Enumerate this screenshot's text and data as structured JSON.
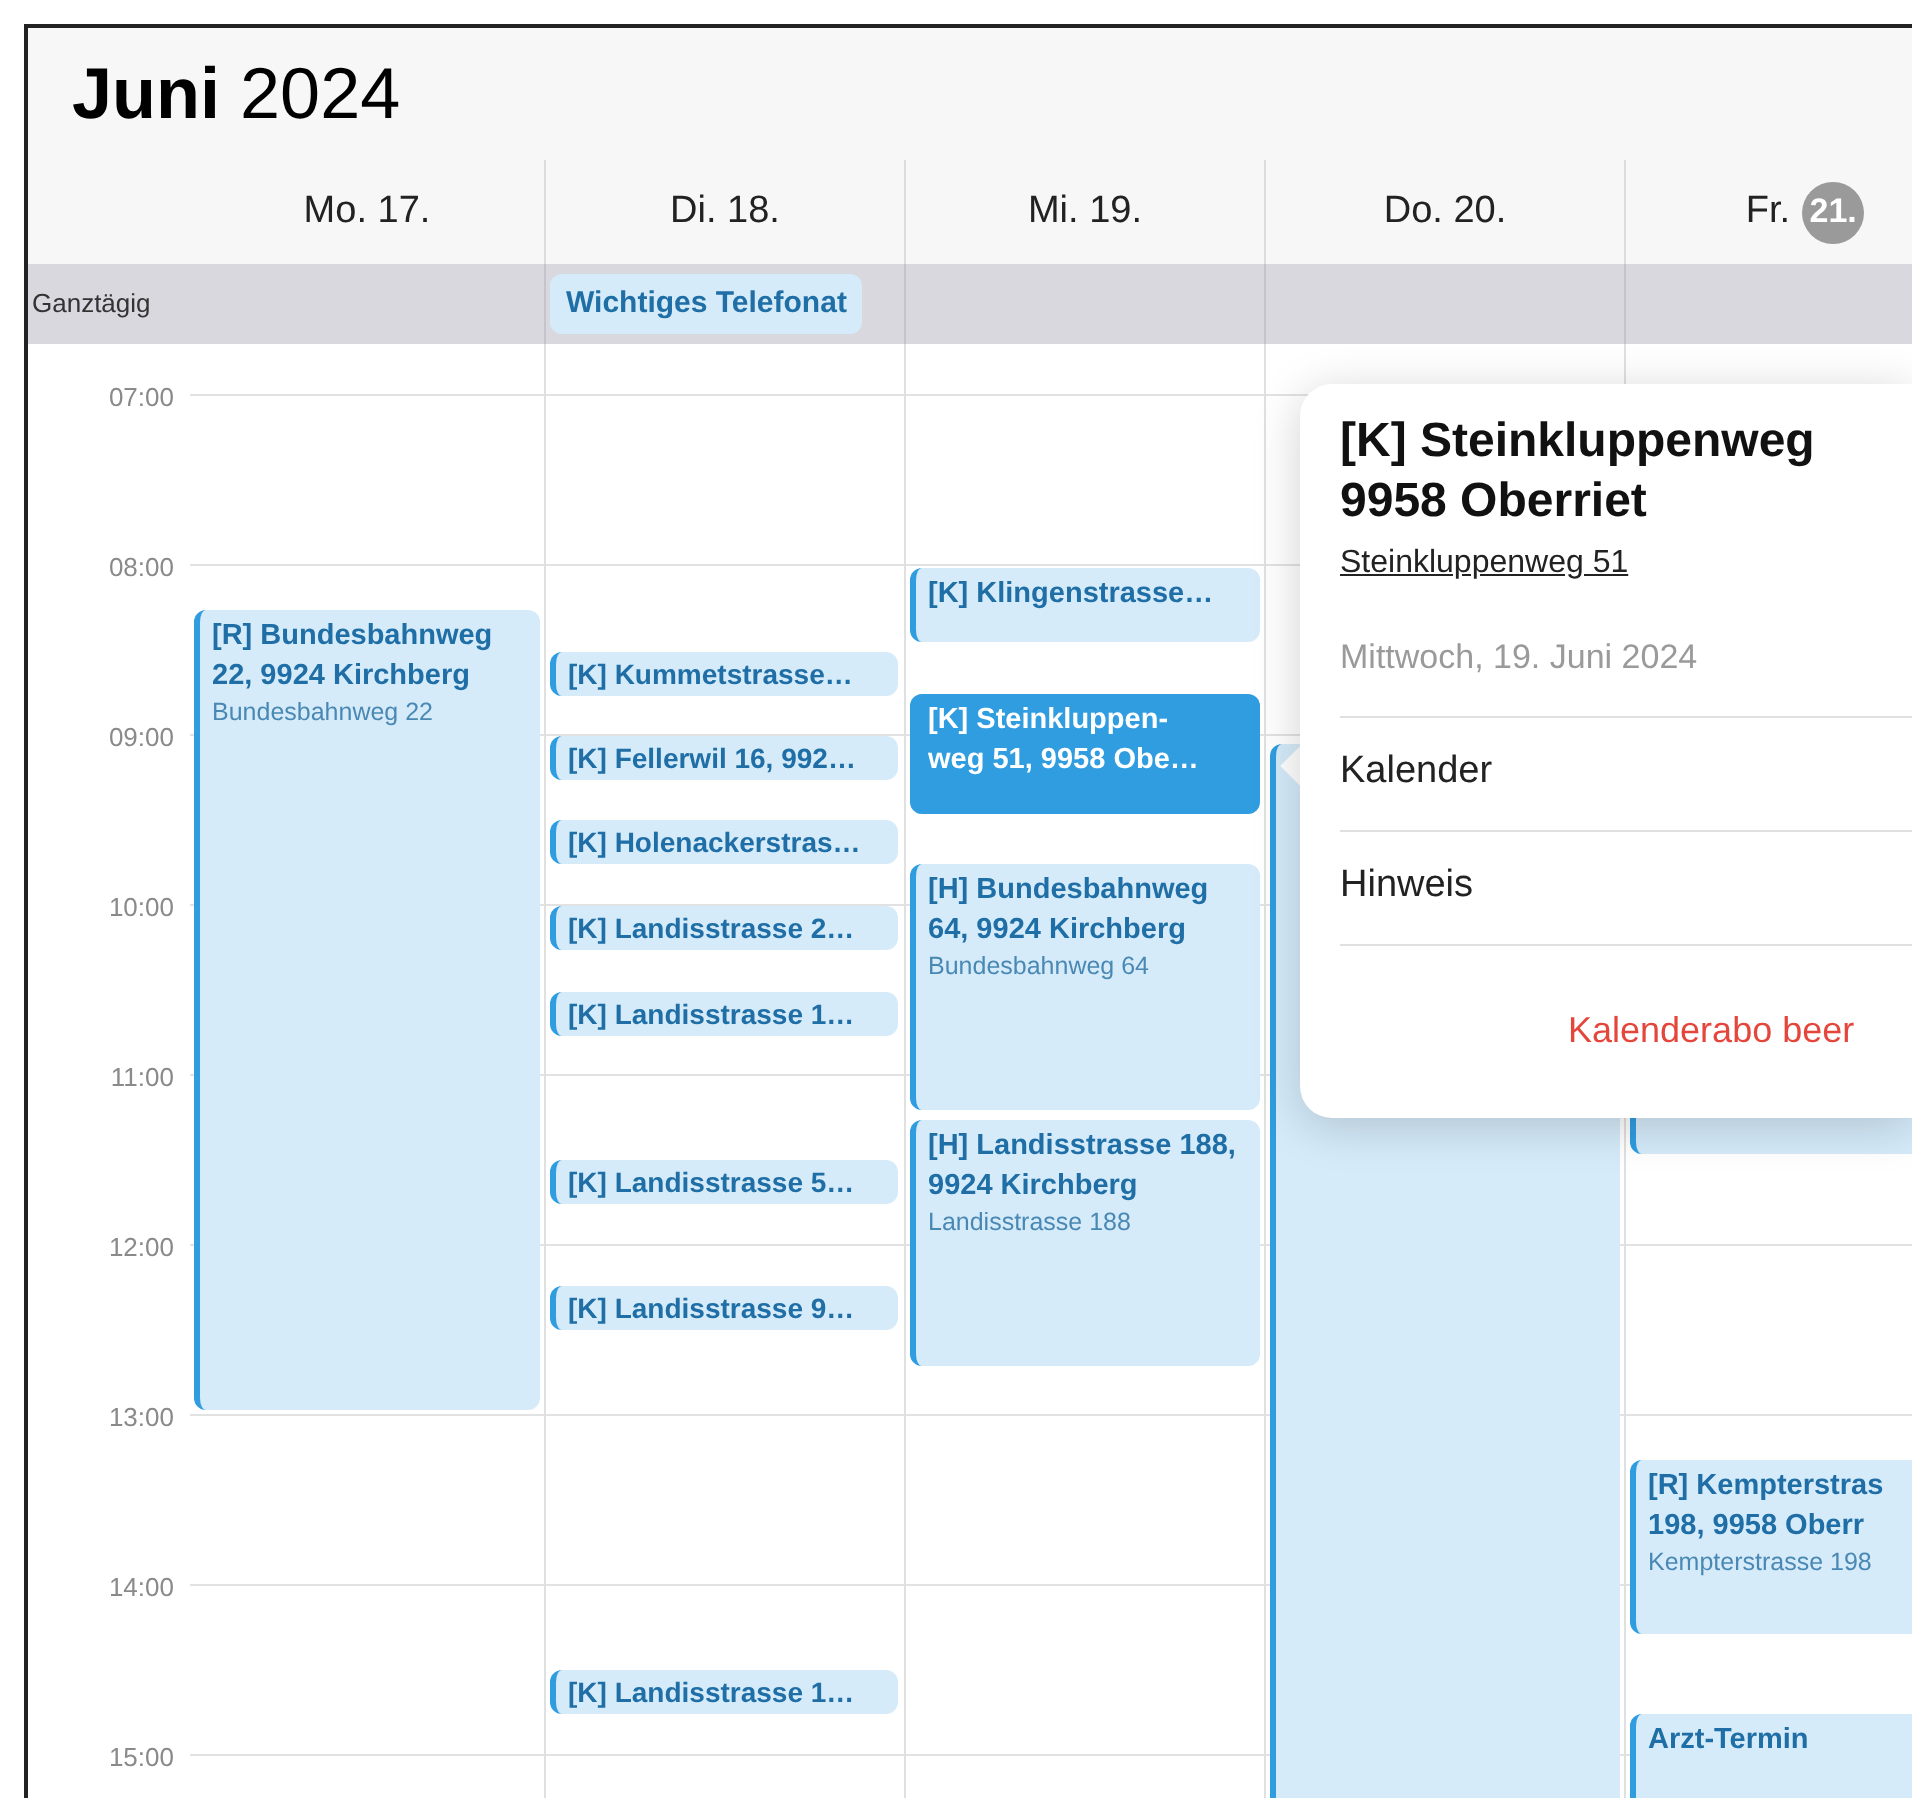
{
  "header": {
    "month": "Juni",
    "year": "2024"
  },
  "all_day_label": "Ganztägig",
  "hours": [
    "07:00",
    "08:00",
    "09:00",
    "10:00",
    "11:00",
    "12:00",
    "13:00",
    "14:00",
    "15:00"
  ],
  "days": [
    {
      "weekday": "Mo.",
      "date": "17.",
      "today": false,
      "events": [
        {
          "kind": "block",
          "title": "[R] Bundesbahnweg 22, 9924 Kirchberg",
          "subtitle": "Bundesbahnweg 22",
          "selected": false
        }
      ]
    },
    {
      "weekday": "Di.",
      "date": "18.",
      "today": false,
      "all_day": [
        "Wichtiges Telefonat"
      ],
      "events": [
        {
          "kind": "chip",
          "title": "[K] Kummetstrasse…",
          "selected": false
        },
        {
          "kind": "chip",
          "title": "[K] Fellerwil 16, 992…",
          "selected": false
        },
        {
          "kind": "chip",
          "title": "[K] Holenackerstras…",
          "selected": false
        },
        {
          "kind": "chip",
          "title": "[K] Landisstrasse 2…",
          "selected": false
        },
        {
          "kind": "chip",
          "title": "[K] Landisstrasse 1…",
          "selected": false
        },
        {
          "kind": "chip",
          "title": "[K] Landisstrasse 5…",
          "selected": false
        },
        {
          "kind": "chip",
          "title": "[K] Landisstrasse 9…",
          "selected": false
        },
        {
          "kind": "chip",
          "title": "[K] Landisstrasse 1…",
          "selected": false
        }
      ]
    },
    {
      "weekday": "Mi.",
      "date": "19.",
      "today": false,
      "events": [
        {
          "kind": "block",
          "title": "[K] Klingenstrasse…",
          "selected": false
        },
        {
          "kind": "block",
          "title": "[K] Steinkluppen-\nweg 51, 9958 Obe…",
          "selected": true
        },
        {
          "kind": "block",
          "title": "[H] Bundesbahnweg 64, 9924 Kirchberg",
          "subtitle": "Bundesbahnweg 64",
          "selected": false
        },
        {
          "kind": "block",
          "title": "[H] Landisstrasse 188, 9924 Kirchberg",
          "subtitle": "Landisstrasse 188",
          "selected": false
        }
      ]
    },
    {
      "weekday": "Do.",
      "date": "20.",
      "today": false,
      "events": [
        {
          "kind": "block",
          "selected": false
        }
      ]
    },
    {
      "weekday": "Fr.",
      "date": "21.",
      "today": true,
      "events": [
        {
          "kind": "block",
          "selected": false
        },
        {
          "kind": "block",
          "title": "[R] Kempterstras\n198, 9958 Oberr",
          "subtitle": "Kempterstrasse 198",
          "selected": false
        },
        {
          "kind": "block",
          "title": "Arzt-Termin",
          "selected": false
        }
      ]
    }
  ],
  "popover": {
    "title": "[K] Steinkluppenweg\n9958 Oberriet",
    "location": "Steinkluppenweg 51",
    "date": "Mittwoch, 19. Juni 2024",
    "rows": [
      "Kalender",
      "Hinweis"
    ],
    "action": "Kalenderabo beer"
  }
}
